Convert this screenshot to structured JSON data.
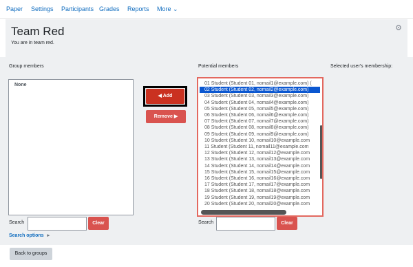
{
  "nav": {
    "items": [
      "Paper",
      "Settings",
      "Participants",
      "Grades",
      "Reports",
      "More ⌄"
    ]
  },
  "header": {
    "title": "Team Red",
    "subtitle": "You are in team red."
  },
  "group_members": {
    "label": "Group members",
    "items": [
      "None"
    ],
    "search_label": "Search",
    "search_value": "",
    "clear_label": "Clear"
  },
  "actions": {
    "add_label": "◀ Add",
    "remove_label": "Remove ▶"
  },
  "potential_members": {
    "label": "Potential members",
    "selected_index": 1,
    "options": [
      "01 Student (Student 01, nomail1@example.com) (",
      "02 Student (Student 02, nomail2@example.com)",
      "03 Student (Student 03, nomail3@example.com)",
      "04 Student (Student 04, nomail4@example.com)",
      "05 Student (Student 05, nomail5@example.com)",
      "06 Student (Student 06, nomail6@example.com)",
      "07 Student (Student 07, nomail7@example.com)",
      "08 Student (Student 08, nomail8@example.com)",
      "09 Student (Student 09, nomail9@example.com)",
      "10 Student (Student 10, nomail10@example.com",
      "11 Student (Student 11, nomail11@example.com",
      "12 Student (Student 12, nomail12@example.com",
      "13 Student (Student 13, nomail13@example.com",
      "14 Student (Student 14, nomail14@example.com",
      "15 Student (Student 15, nomail15@example.com",
      "16 Student (Student 16, nomail16@example.com",
      "17 Student (Student 17, nomail17@example.com",
      "18 Student (Student 18, nomail18@example.com",
      "19 Student (Student 19, nomail19@example.com",
      "20 Student (Student 20, nomail20@example.com"
    ],
    "search_label": "Search",
    "search_value": "",
    "clear_label": "Clear"
  },
  "membership": {
    "label": "Selected user's membership:"
  },
  "search_options": {
    "label": "Search options",
    "icon": "caret-right-icon"
  },
  "footer": {
    "back_label": "Back to groups"
  },
  "colors": {
    "link": "#0f6cbf",
    "add_button": "#ca3120",
    "remove_button": "#d9534f",
    "selected_option": "#0b57d0",
    "panel_bg": "#eef0f2"
  }
}
